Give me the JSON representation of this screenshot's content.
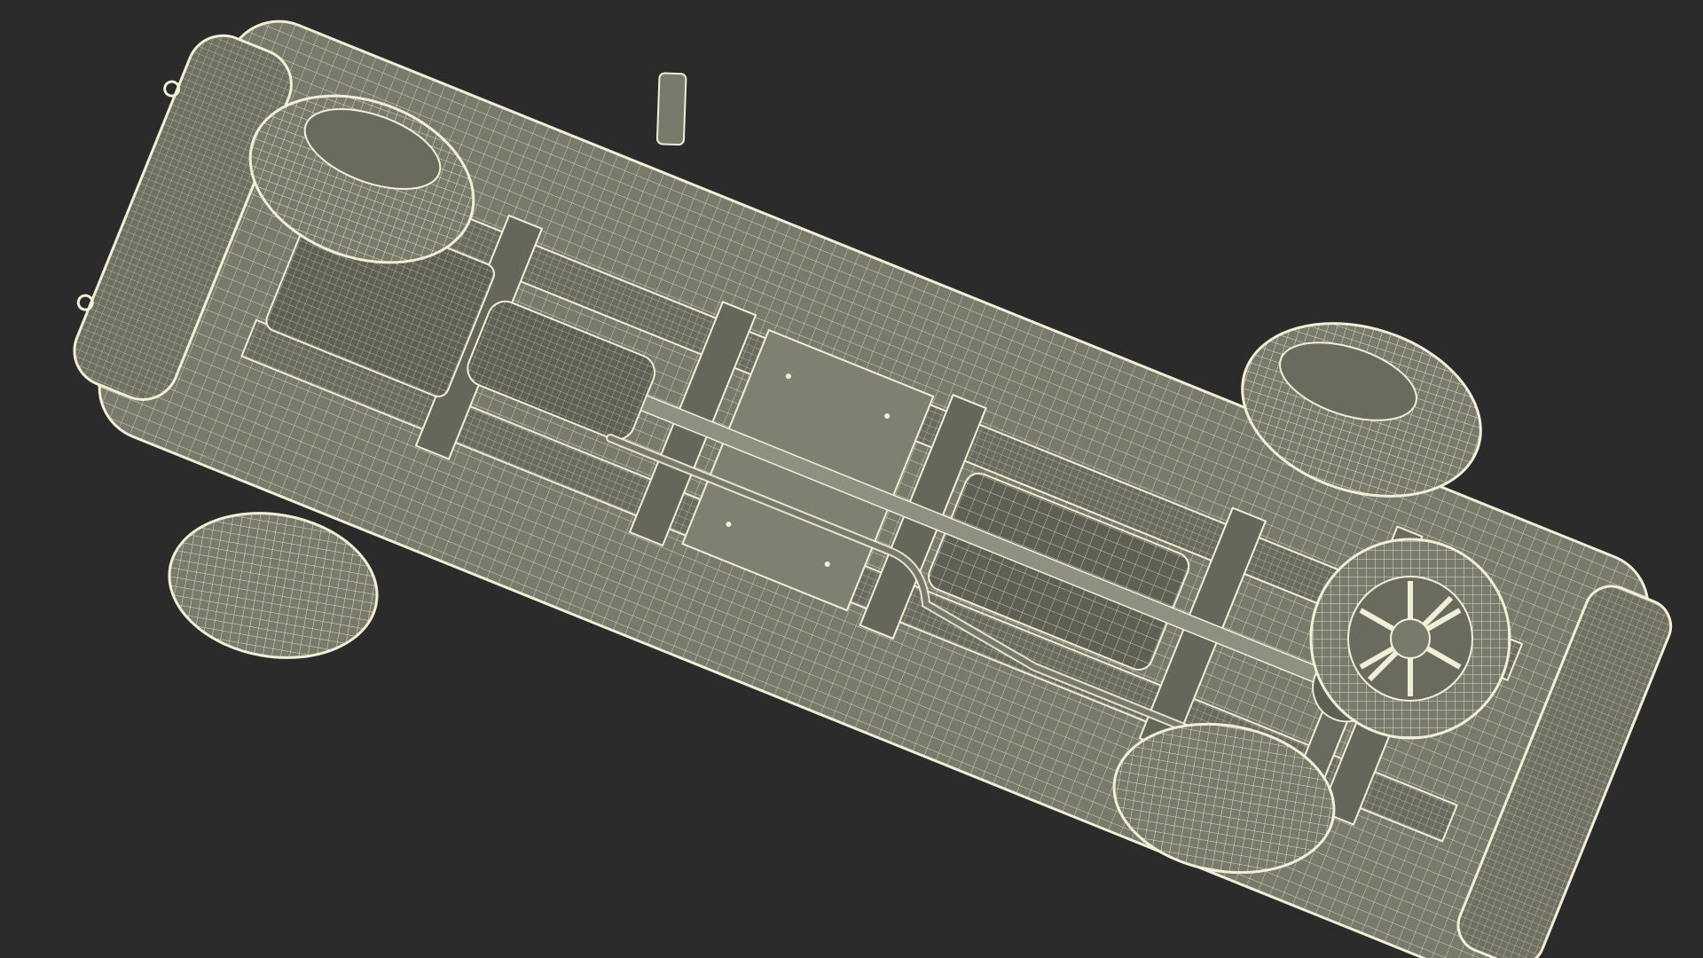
{
  "scene": {
    "background_color": "#2b2b2b",
    "mesh_fill": "#7a7a6c",
    "mesh_shade": "#5f5f54",
    "wire_color": "#f2efd8",
    "subject": "vehicle-underside-wireframe-render"
  }
}
